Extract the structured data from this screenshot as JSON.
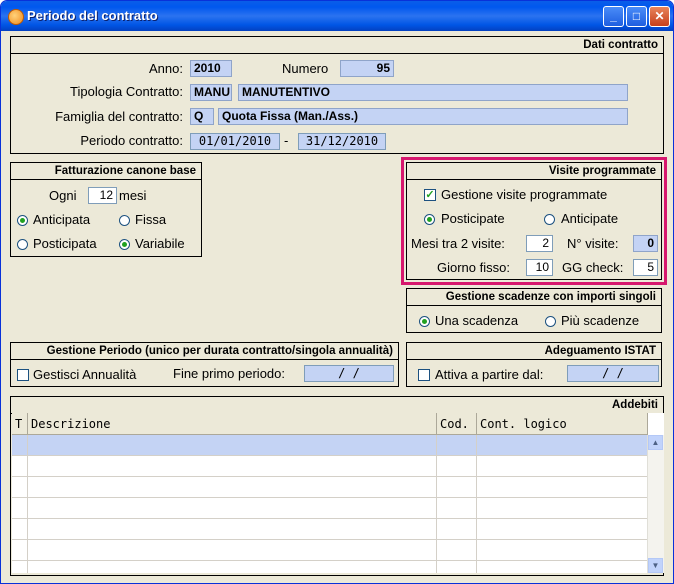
{
  "window": {
    "title": "Periodo del contratto",
    "btn_min": "_",
    "btn_max": "□",
    "btn_close": "✕"
  },
  "dati": {
    "header": "Dati contratto",
    "anno_label": "Anno:",
    "anno": "2010",
    "numero_label": "Numero",
    "numero": "95",
    "tipologia_label": "Tipologia Contratto:",
    "tipologia_code": "MANU",
    "tipologia_desc": "MANUTENTIVO",
    "famiglia_label": "Famiglia del contratto:",
    "famiglia_code": "Q",
    "famiglia_desc": "Quota Fissa (Man./Ass.)",
    "periodo_label": "Periodo contratto:",
    "periodo_da": "01/01/2010",
    "periodo_sep": "-",
    "periodo_a": "31/12/2010"
  },
  "fatturazione": {
    "header": "Fatturazione canone base",
    "ogni_label": "Ogni",
    "ogni_value": "12",
    "mesi_label": "mesi",
    "anticipata": "Anticipata",
    "fissa": "Fissa",
    "posticipata": "Posticipata",
    "variabile": "Variabile"
  },
  "visite": {
    "header": "Visite programmate",
    "gestione_label": "Gestione visite programmate",
    "gestione_checked": true,
    "posticipate": "Posticipate",
    "anticipate": "Anticipate",
    "mesi_label": "Mesi tra 2 visite:",
    "mesi_value": "2",
    "nvisite_label": "N° visite:",
    "nvisite_value": "0",
    "giorno_label": "Giorno fisso:",
    "giorno_value": "10",
    "ggcheck_label": "GG check:",
    "ggcheck_value": "5",
    "highlight_color": "#d6186e"
  },
  "scadenze": {
    "header": "Gestione scadenze con importi singoli",
    "una": "Una scadenza",
    "piu": "Più scadenze"
  },
  "gestione_periodo": {
    "header": "Gestione Periodo (unico per durata contratto/singola annualità)",
    "annualita": "Gestisci Annualità",
    "fine_label": "Fine primo periodo:",
    "fine_value": "/ /"
  },
  "istat": {
    "header": "Adeguamento ISTAT",
    "attiva": "Attiva a partire dal:",
    "date_value": "/ /"
  },
  "addebiti": {
    "header": "Addebiti",
    "columns": [
      "T",
      "Descrizione",
      "Cod.",
      "Cont. logico"
    ],
    "selected_row_color": "#c4d3f4"
  },
  "icons": {
    "scroll_up": "▲",
    "scroll_down": "▼"
  }
}
